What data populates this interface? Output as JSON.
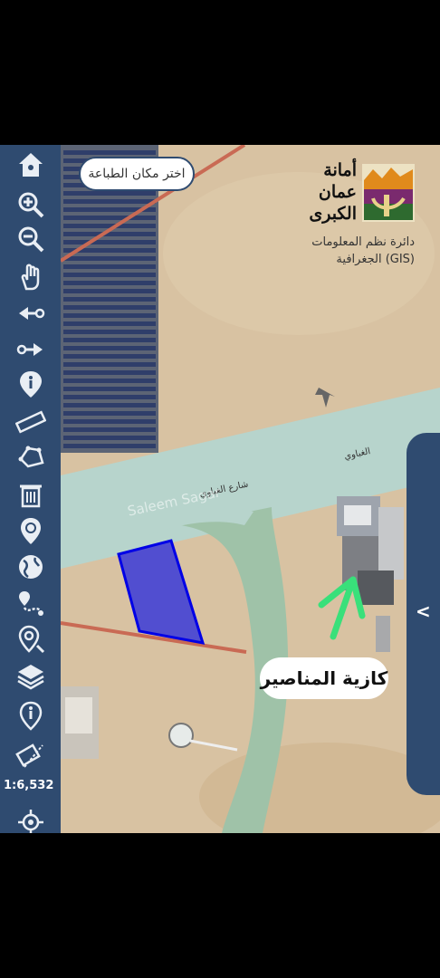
{
  "toolbar": {
    "scale_label": "1:6,532",
    "tools": [
      {
        "name": "home-icon"
      },
      {
        "name": "zoom-in-icon"
      },
      {
        "name": "zoom-out-icon"
      },
      {
        "name": "pan-hand-icon"
      },
      {
        "name": "previous-extent-icon"
      },
      {
        "name": "next-extent-icon"
      },
      {
        "name": "info-icon"
      },
      {
        "name": "measure-ruler-icon"
      },
      {
        "name": "draw-polygon-icon"
      },
      {
        "name": "trash-icon"
      },
      {
        "name": "location-pin-icon"
      },
      {
        "name": "globe-icon"
      },
      {
        "name": "route-icon"
      },
      {
        "name": "search-location-icon"
      },
      {
        "name": "layers-icon"
      },
      {
        "name": "legend-info-icon"
      },
      {
        "name": "print-icon"
      },
      {
        "name": "gps-locate-icon"
      }
    ]
  },
  "print": {
    "button_label": "اختر مكان الطباعة"
  },
  "branding": {
    "title_line1": "أمانة",
    "title_line2": "عمان",
    "title_line3": "الكبرى",
    "dept_line1": "دائرة نظم المعلومات",
    "dept_line2": "الجغرافية (GIS)"
  },
  "map": {
    "road_name_1": "الغباوي",
    "road_name_2": "شارع الغباوي",
    "watermark": "Saleem Sagar",
    "annotation": "كازية المناصير",
    "highlight_color": "#3a3ad8",
    "arrow_color": "#39e07a"
  },
  "side_panel": {
    "toggle_label": "<"
  }
}
